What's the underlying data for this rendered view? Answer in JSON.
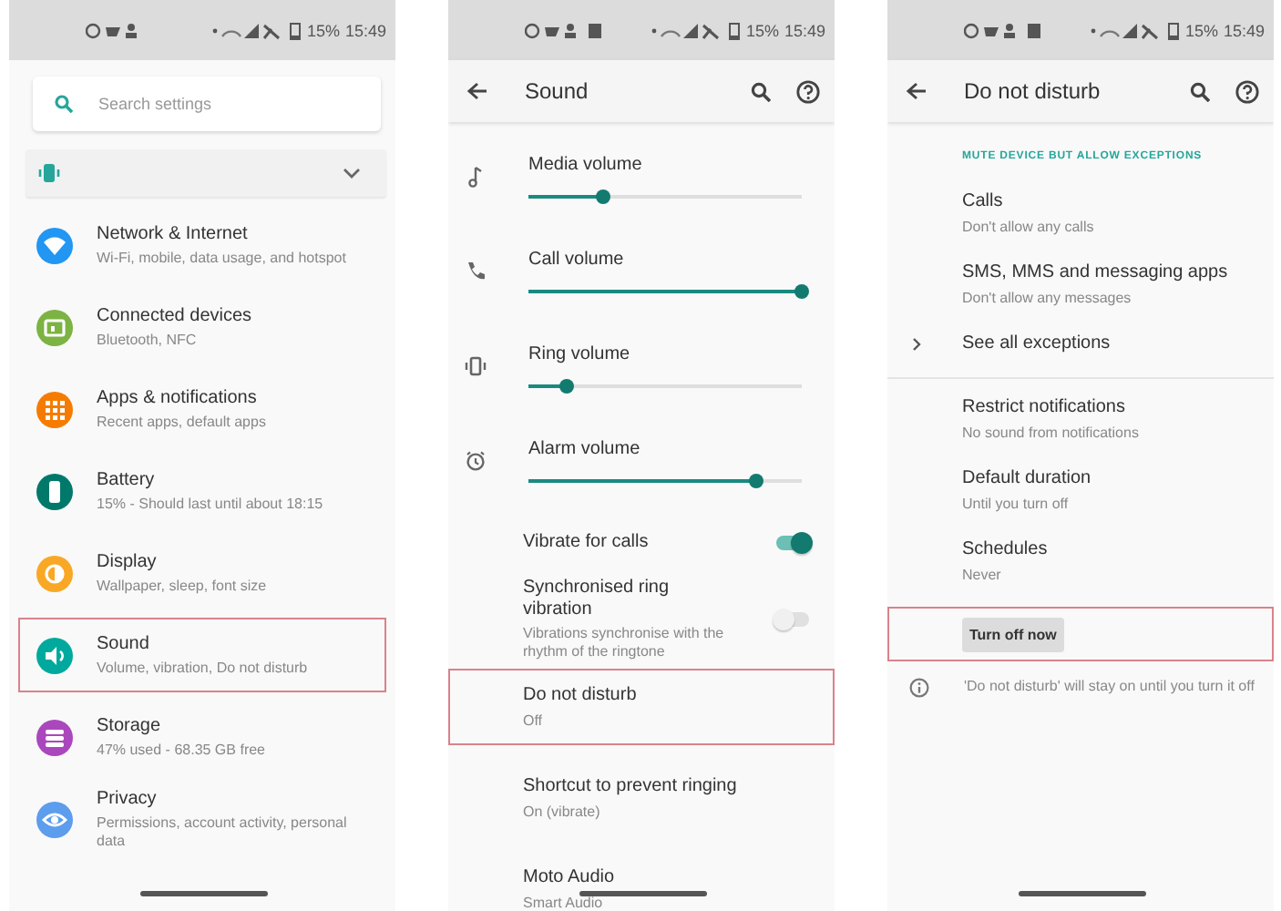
{
  "screens": [
    {
      "kind": "settings",
      "status_bar": {
        "battery": "15%",
        "time": "15:49"
      },
      "search": {
        "placeholder": "Search settings"
      },
      "suggestion": {
        "expanded": false
      },
      "items": [
        {
          "title": "Network & Internet",
          "subtitle": "Wi-Fi, mobile, data usage, and hotspot",
          "color": "#2196f3",
          "highlighted": false
        },
        {
          "title": "Connected devices",
          "subtitle": "Bluetooth, NFC",
          "color": "#7cb342",
          "highlighted": false
        },
        {
          "title": "Apps & notifications",
          "subtitle": "Recent apps, default apps",
          "color": "#f57c00",
          "highlighted": false
        },
        {
          "title": "Battery",
          "subtitle": "15% - Should last until about 18:15",
          "color": "#00796b",
          "highlighted": false
        },
        {
          "title": "Display",
          "subtitle": "Wallpaper, sleep, font size",
          "color": "#f9a825",
          "highlighted": false
        },
        {
          "title": "Sound",
          "subtitle": "Volume, vibration, Do not disturb",
          "color": "#00a99d",
          "highlighted": true
        },
        {
          "title": "Storage",
          "subtitle": "47% used - 68.35 GB free",
          "color": "#ab47bc",
          "highlighted": false
        },
        {
          "title": "Privacy",
          "subtitle": "Permissions, account activity, personal data",
          "color": "#5c9ded",
          "highlighted": false
        }
      ]
    },
    {
      "kind": "sound",
      "status_bar": {
        "battery": "15%",
        "time": "15:49"
      },
      "title": "Sound",
      "items": [
        {
          "kind": "slider",
          "label": "Media volume",
          "level": 0.27
        },
        {
          "kind": "slider",
          "label": "Call volume",
          "level": 1.0
        },
        {
          "kind": "slider",
          "label": "Ring volume",
          "level": 0.14
        },
        {
          "kind": "slider",
          "label": "Alarm volume",
          "level": 0.83
        },
        {
          "kind": "toggle",
          "title": "Vibrate for calls",
          "on": true
        },
        {
          "kind": "toggle",
          "title": "Synchronised ring vibration",
          "subtitle": "Vibrations synchronise with the rhythm of the ringtone",
          "on": false
        },
        {
          "kind": "link",
          "title": "Do not disturb",
          "subtitle": "Off",
          "highlighted": true
        },
        {
          "kind": "link",
          "title": "Shortcut to prevent ringing",
          "subtitle": "On (vibrate)",
          "highlighted": false
        },
        {
          "kind": "link",
          "title": "Moto Audio",
          "subtitle": "Smart Audio",
          "highlighted": false
        }
      ]
    },
    {
      "kind": "dnd",
      "status_bar": {
        "battery": "15%",
        "time": "15:49"
      },
      "title": "Do not disturb",
      "section": "MUTE DEVICE BUT ALLOW EXCEPTIONS",
      "items": [
        {
          "kind": "link",
          "title": "Calls",
          "subtitle": "Don't allow any calls"
        },
        {
          "kind": "link",
          "title": "SMS, MMS and messaging apps",
          "subtitle": "Don't allow any messages"
        },
        {
          "kind": "expander",
          "title": "See all exceptions",
          "expanded": false
        },
        {
          "kind": "divider"
        },
        {
          "kind": "link",
          "title": "Restrict notifications",
          "subtitle": "No sound from notifications"
        },
        {
          "kind": "link",
          "title": "Default duration",
          "subtitle": "Until you turn off"
        },
        {
          "kind": "link",
          "title": "Schedules",
          "subtitle": "Never"
        },
        {
          "kind": "button",
          "label": "Turn off now",
          "highlighted": true
        },
        {
          "kind": "info",
          "text": "'Do not disturb' will stay on until you turn it off"
        }
      ]
    }
  ]
}
